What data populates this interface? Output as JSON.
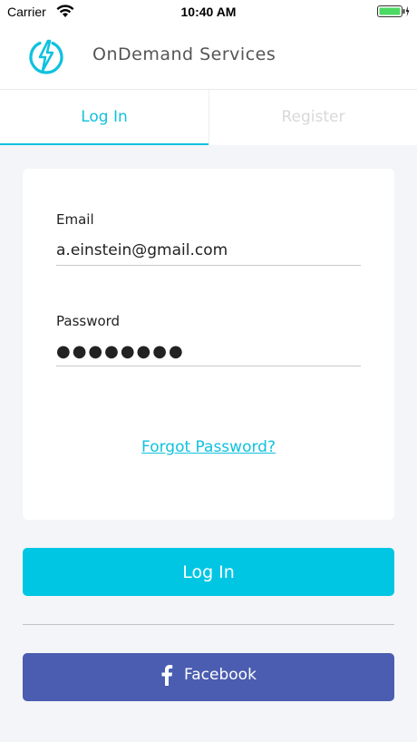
{
  "status_bar": {
    "carrier": "Carrier",
    "time": "10:40 AM",
    "battery_color": "#4cd964"
  },
  "app_bar": {
    "title": "OnDemand Services",
    "logo_icon": "lightning-bolt-icon",
    "accent_color": "#10c1df"
  },
  "tabs": [
    {
      "label": "Log In",
      "active": true
    },
    {
      "label": "Register",
      "active": false
    }
  ],
  "form": {
    "email_label": "Email",
    "email_value": "a.einstein@gmail.com",
    "password_label": "Password",
    "password_value": "●●●●●●●●",
    "forgot_label": "Forgot Password?"
  },
  "buttons": {
    "login_label": "Log In",
    "login_color": "#00c6e4",
    "facebook_label": "Facebook",
    "facebook_color": "#4a5db0",
    "facebook_icon": "facebook-f-icon"
  }
}
